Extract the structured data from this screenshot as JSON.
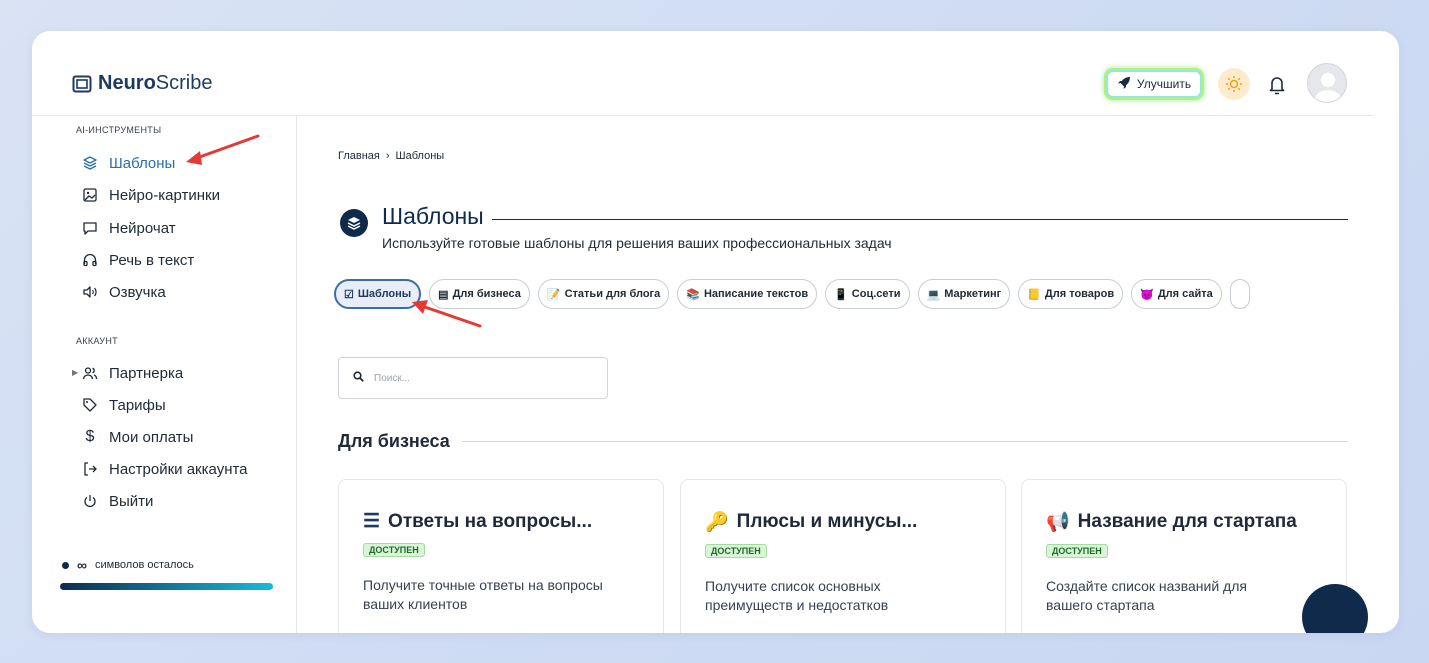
{
  "app": {
    "brand_bold": "Neuro",
    "brand_rest": "Scribe"
  },
  "header": {
    "upgrade_label": "Улучшить"
  },
  "sidebar": {
    "ai_section": "AI-ИНСТРУМЕНТЫ",
    "ai_items": [
      {
        "label": "Шаблоны",
        "icon": "layers-icon"
      },
      {
        "label": "Нейро-картинки",
        "icon": "image-icon"
      },
      {
        "label": "Нейрочат",
        "icon": "chat-icon"
      },
      {
        "label": "Речь в текст",
        "icon": "headphones-icon"
      },
      {
        "label": "Озвучка",
        "icon": "speaker-icon"
      }
    ],
    "account_section": "АККАУНТ",
    "account_items": [
      {
        "label": "Партнерка",
        "icon": "users-icon"
      },
      {
        "label": "Тарифы",
        "icon": "tag-icon"
      },
      {
        "label": "Мои оплаты",
        "icon": "dollar-icon"
      },
      {
        "label": "Настройки аккаунта",
        "icon": "login-icon"
      },
      {
        "label": "Выйти",
        "icon": "power-icon"
      }
    ],
    "symbols_value": "∞",
    "symbols_label": "символов осталось"
  },
  "breadcrumb": {
    "home": "Главная",
    "sep": "›",
    "current": "Шаблоны"
  },
  "page": {
    "title": "Шаблоны",
    "subtitle": "Используйте готовые шаблоны для решения ваших профессиональных задач"
  },
  "chips": [
    {
      "emoji": "☑",
      "label": "Шаблоны"
    },
    {
      "emoji": "▤",
      "label": "Для бизнеса"
    },
    {
      "emoji": "📝",
      "label": "Статьи для блога"
    },
    {
      "emoji": "📚",
      "label": "Написание текстов"
    },
    {
      "emoji": "📱",
      "label": "Соц.сети"
    },
    {
      "emoji": "💻",
      "label": "Маркетинг"
    },
    {
      "emoji": "📒",
      "label": "Для товаров"
    },
    {
      "emoji": "😈",
      "label": "Для сайта"
    }
  ],
  "search": {
    "placeholder": "Поиск..."
  },
  "section_title": "Для бизнеса",
  "cards": [
    {
      "icon": "☰",
      "title": "Ответы на вопросы...",
      "badge": "ДОСТУПЕН",
      "desc": "Получите точные ответы на вопросы ваших клиентов"
    },
    {
      "icon": "🔑",
      "title": "Плюсы и минусы...",
      "badge": "ДОСТУПЕН",
      "desc": "Получите список основных преимуществ и недостатков"
    },
    {
      "icon": "📢",
      "title": "Название для стартапа",
      "badge": "ДОСТУПЕН",
      "desc": "Создайте список названий для вашего стартапа"
    }
  ]
}
